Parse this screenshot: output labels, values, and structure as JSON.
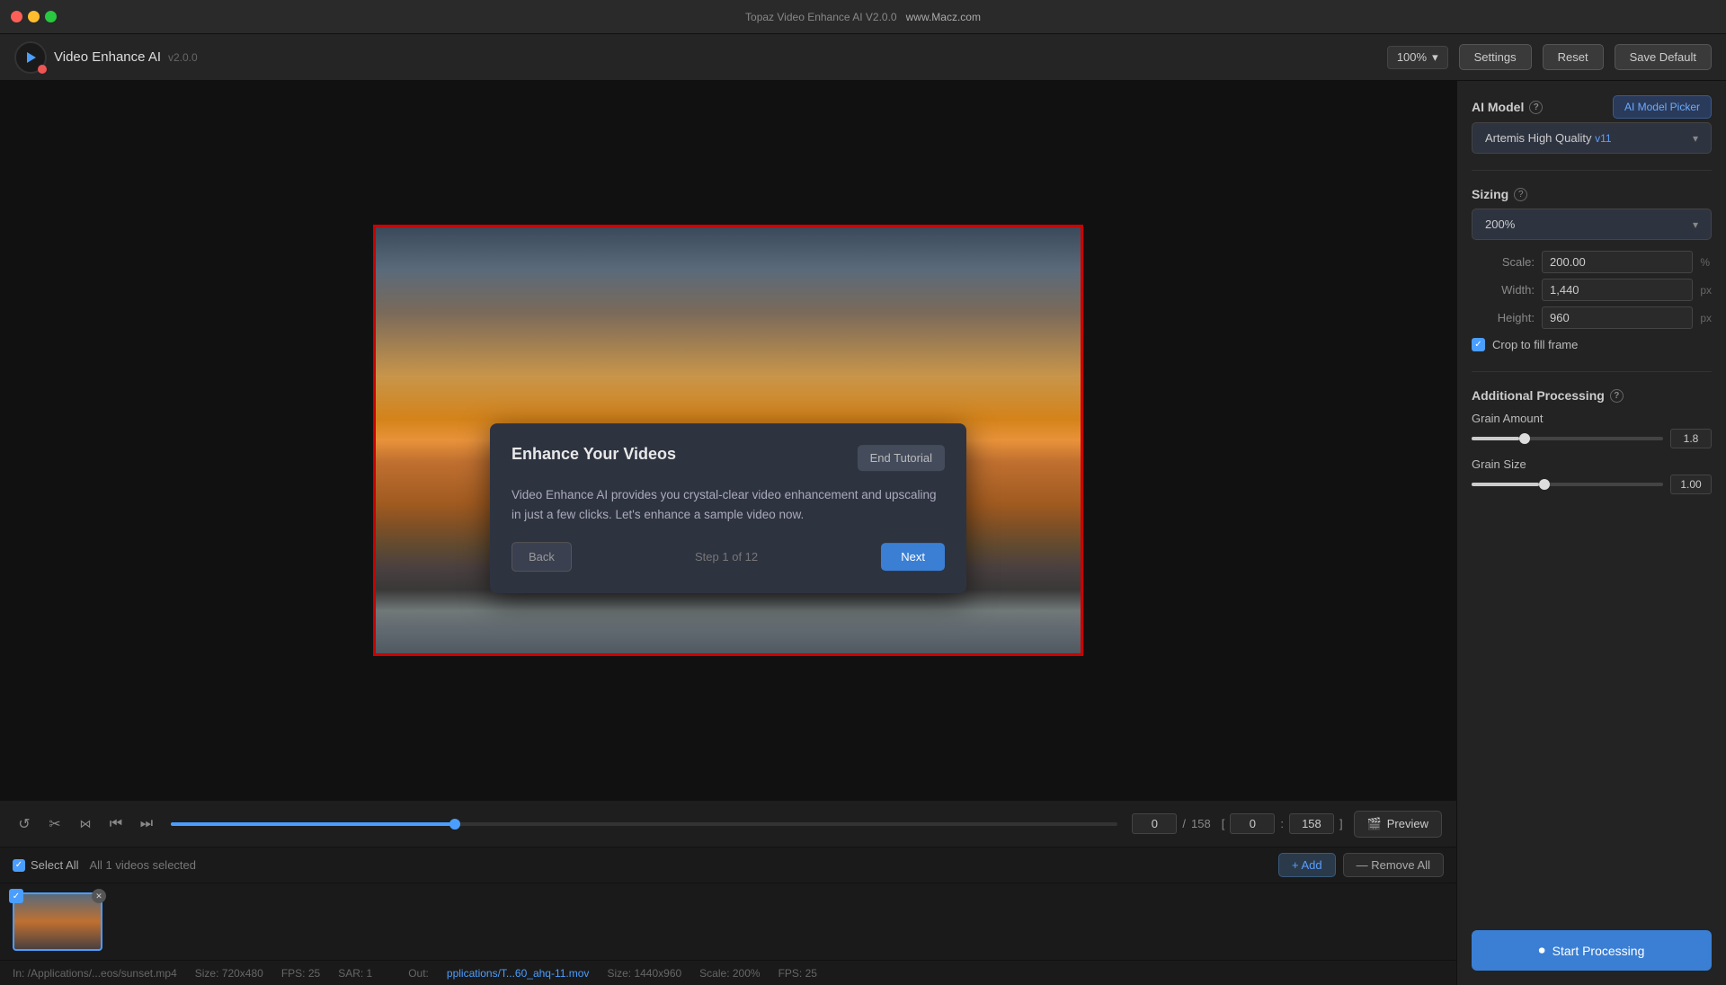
{
  "titlebar": {
    "title": "Topaz Video Enhance AI V2.0.0",
    "subtitle": "www.Macz.com"
  },
  "header": {
    "app_name": "Video Enhance AI",
    "version": "v2.0.0",
    "zoom": "100%",
    "settings_label": "Settings",
    "reset_label": "Reset",
    "save_default_label": "Save Default"
  },
  "ai_model": {
    "section_title": "AI Model",
    "picker_label": "AI Model Picker",
    "selected_model": "Artemis High Quality",
    "selected_version": "v11"
  },
  "sizing": {
    "section_title": "Sizing",
    "selected_size": "200%",
    "scale_label": "Scale:",
    "scale_value": "200.00",
    "scale_unit": "%",
    "width_label": "Width:",
    "width_value": "1,440",
    "width_unit": "px",
    "height_label": "Height:",
    "height_value": "960",
    "height_unit": "px",
    "crop_label": "Crop to fill frame"
  },
  "additional_processing": {
    "section_title": "Additional Processing",
    "grain_amount_label": "Grain Amount",
    "grain_amount_value": "1.8",
    "grain_amount_fill_pct": 25,
    "grain_amount_thumb_pct": 25,
    "grain_size_label": "Grain Size",
    "grain_size_value": "1.00",
    "grain_size_fill_pct": 35,
    "grain_size_thumb_pct": 35
  },
  "start_processing": {
    "label": "Start Processing"
  },
  "transport": {
    "current_frame": "0",
    "total_frames": "158",
    "range_start": "0",
    "range_end": "158",
    "preview_label": "Preview",
    "progress_pct": 30
  },
  "file_list": {
    "select_all_label": "Select All",
    "selected_info": "All 1 videos selected",
    "add_label": "+ Add",
    "remove_label": "— Remove All"
  },
  "status_bar": {
    "in_path": "In: /Applications/...eos/sunset.mp4",
    "size": "Size: 720x480",
    "fps": "FPS: 25",
    "sar": "SAR: 1",
    "out_path": "pplications/T...60_ahq-11.mov",
    "out_size": "Size: 1440x960",
    "out_scale": "Scale: 200%",
    "out_fps": "FPS: 25"
  },
  "tutorial": {
    "title": "Enhance Your Videos",
    "end_button": "End Tutorial",
    "body": "Video Enhance AI provides you crystal-clear video enhancement and upscaling in just a few clicks. Let's enhance a sample video now.",
    "back_label": "Back",
    "step_label": "Step 1 of 12",
    "next_label": "Next"
  }
}
